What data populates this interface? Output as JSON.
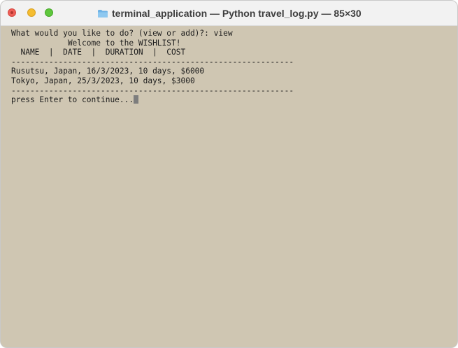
{
  "window": {
    "title": "terminal_application — Python travel_log.py — 85×30",
    "icons": {
      "close": "close-icon",
      "minimize": "minimize-icon",
      "zoom": "zoom-icon",
      "folder": "folder-icon"
    },
    "colors": {
      "terminal_background": "#cfc6b2",
      "text": "#1c1c1c",
      "close": "#ee5e57",
      "minimize": "#f5bd30",
      "zoom": "#5fc73d"
    }
  },
  "terminal": {
    "prompt_line": "What would you like to do? (view or add)?: view",
    "welcome_line": "            Welcome to the WISHLIST!",
    "header_line": "  NAME  |  DATE  |  DURATION  |  COST",
    "separator_top": "------------------------------------------------------------",
    "entries": [
      "Rusutsu, Japan, 16/3/2023, 10 days, $6000",
      "Tokyo, Japan, 25/3/2023, 10 days, $3000"
    ],
    "separator_bottom": "------------------------------------------------------------",
    "continue_prompt": "press Enter to continue..."
  }
}
